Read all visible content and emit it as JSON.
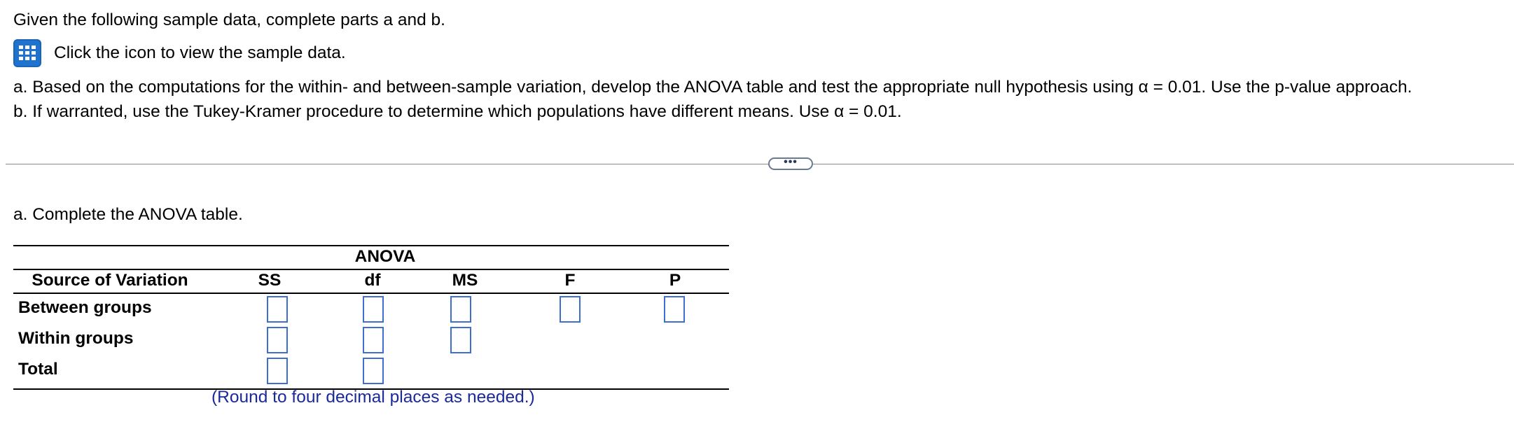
{
  "question": {
    "intro": "Given the following sample data, complete parts a and b.",
    "data_link": "Click the icon to view the sample data.",
    "data_icon": "table-grid-icon",
    "part_a": "a. Based on the computations for the within- and between-sample variation, develop the ANOVA table and test the appropriate null hypothesis using α = 0.01. Use the p-value approach.",
    "part_b": "b. If warranted, use the Tukey-Kramer procedure to determine which populations have different means. Use α = 0.01."
  },
  "divider": {
    "more_label": "•••"
  },
  "answer": {
    "sub_prompt": "a. Complete the ANOVA table.",
    "table": {
      "title": "ANOVA",
      "headers": {
        "source": "Source of Variation",
        "ss": "SS",
        "df": "df",
        "ms": "MS",
        "f": "F",
        "p": "P"
      },
      "rows": [
        {
          "label": "Between groups",
          "ss": "",
          "df": "",
          "ms": "",
          "f": "",
          "p": ""
        },
        {
          "label": "Within groups",
          "ss": "",
          "df": "",
          "ms": ""
        },
        {
          "label": "Total",
          "ss": "",
          "df": ""
        }
      ]
    },
    "note": "(Round to four decimal places as needed.)"
  },
  "colors": {
    "input_border": "#3e6fd0",
    "icon_fill": "#1f73cf",
    "note_text": "#1a2a9a"
  }
}
